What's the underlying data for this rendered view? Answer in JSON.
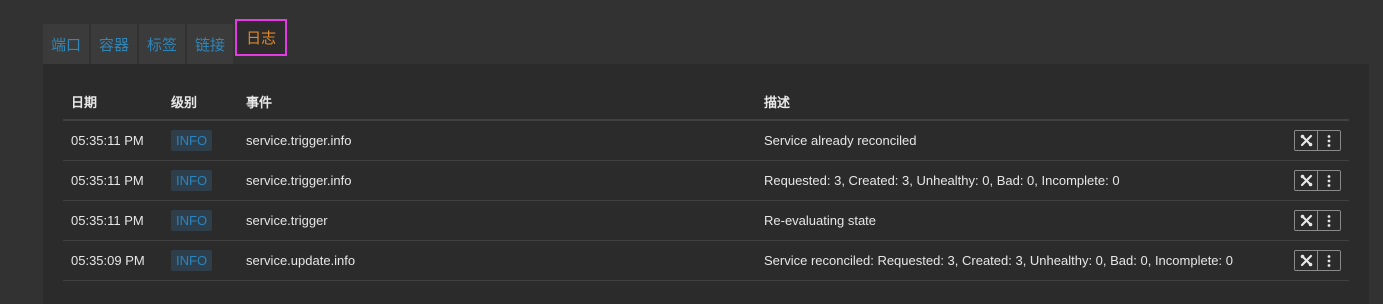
{
  "tabs": [
    {
      "label": "端口"
    },
    {
      "label": "容器"
    },
    {
      "label": "标签"
    },
    {
      "label": "链接"
    },
    {
      "label": "日志"
    }
  ],
  "active_tab": "日志",
  "table": {
    "headers": [
      "日期",
      "级别",
      "事件",
      "描述"
    ],
    "rows": [
      {
        "date": "05:35:11 PM",
        "level": "INFO",
        "event": "service.trigger.info",
        "description": "Service already reconciled"
      },
      {
        "date": "05:35:11 PM",
        "level": "INFO",
        "event": "service.trigger.info",
        "description": "Requested: 3, Created: 3, Unhealthy: 0, Bad: 0, Incomplete: 0"
      },
      {
        "date": "05:35:11 PM",
        "level": "INFO",
        "event": "service.trigger",
        "description": "Re-evaluating state"
      },
      {
        "date": "05:35:09 PM",
        "level": "INFO",
        "event": "service.update.info",
        "description": "Service reconciled: Requested: 3, Created: 3, Unhealthy: 0, Bad: 0, Incomplete: 0"
      }
    ]
  },
  "row_actions": {
    "primary_icon": "tools-icon",
    "secondary_icon": "more-vertical-icon"
  },
  "colors": {
    "background": "#323232",
    "panel": "#2b2b2b",
    "tab_text": "#2f86b8",
    "active_tab_text": "#e0872a",
    "highlight_outline": "#e33ae3",
    "badge_text": "#2a86bf"
  }
}
